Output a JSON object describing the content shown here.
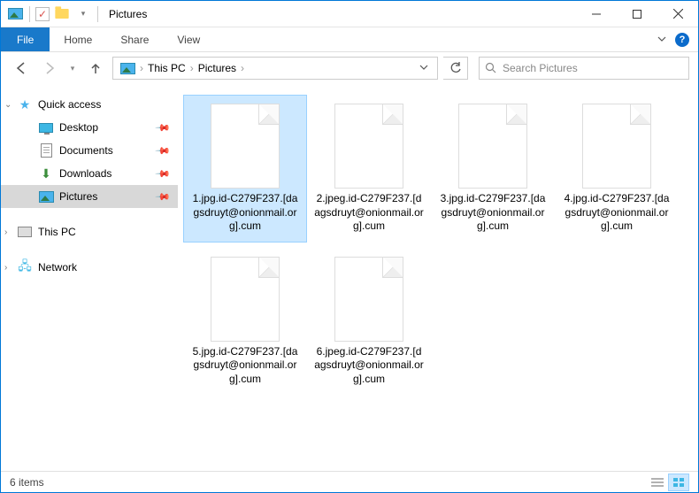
{
  "window": {
    "title": "Pictures"
  },
  "ribbon": {
    "file": "File",
    "tabs": [
      "Home",
      "Share",
      "View"
    ]
  },
  "breadcrumb": {
    "items": [
      "This PC",
      "Pictures"
    ]
  },
  "search": {
    "placeholder": "Search Pictures"
  },
  "nav": {
    "quick_access": "Quick access",
    "items": [
      {
        "label": "Desktop",
        "icon": "monitor",
        "pinned": true
      },
      {
        "label": "Documents",
        "icon": "doc",
        "pinned": true
      },
      {
        "label": "Downloads",
        "icon": "down",
        "pinned": true
      },
      {
        "label": "Pictures",
        "icon": "pic",
        "pinned": true,
        "selected": true
      }
    ],
    "this_pc": "This PC",
    "network": "Network"
  },
  "files": [
    {
      "name": "1.jpg.id-C279F237.[dagsdruyt@onionmail.org].cum",
      "selected": true
    },
    {
      "name": "2.jpeg.id-C279F237.[dagsdruyt@onionmail.org].cum",
      "selected": false
    },
    {
      "name": "3.jpg.id-C279F237.[dagsdruyt@onionmail.org].cum",
      "selected": false
    },
    {
      "name": "4.jpg.id-C279F237.[dagsdruyt@onionmail.org].cum",
      "selected": false
    },
    {
      "name": "5.jpg.id-C279F237.[dagsdruyt@onionmail.org].cum",
      "selected": false
    },
    {
      "name": "6.jpeg.id-C279F237.[dagsdruyt@onionmail.org].cum",
      "selected": false
    }
  ],
  "status": {
    "count_label": "6 items"
  }
}
